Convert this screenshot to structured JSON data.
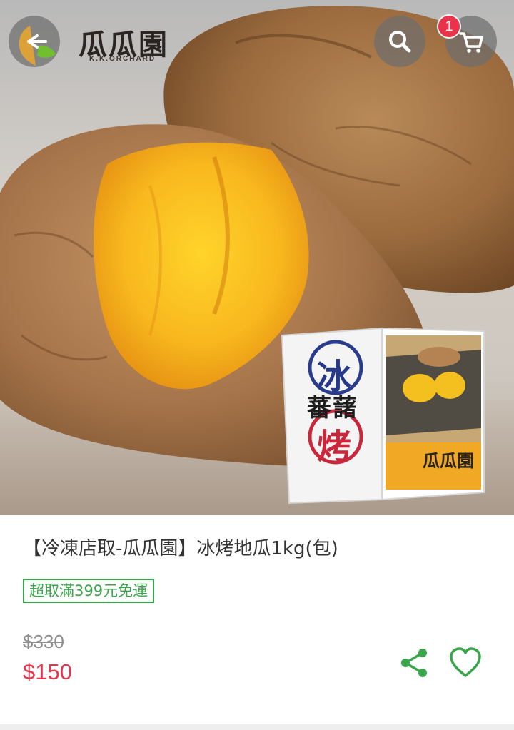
{
  "header": {
    "back_icon": "arrow-left-icon",
    "brand": {
      "name": "瓜瓜園",
      "sub": "K.K.ORCHARD"
    },
    "search_icon": "search-icon",
    "cart_icon": "cart-icon",
    "cart_count": "1"
  },
  "hero": {
    "box": {
      "big_1": "冰",
      "middle": "蕃藷",
      "big_2": "烤",
      "brand": "瓜瓜園"
    }
  },
  "product": {
    "title": "【冷凍店取-瓜瓜園】冰烤地瓜1kg(包)",
    "promo_tag": "超取滿399元免運",
    "old_price": "$330",
    "price": "$150"
  },
  "actions": {
    "share_icon": "share-icon",
    "favorite_icon": "heart-outline-icon"
  },
  "colors": {
    "price": "#e8334a",
    "promo": "#3aa64c",
    "action": "#3aa64c",
    "badge": "#e8334a"
  }
}
